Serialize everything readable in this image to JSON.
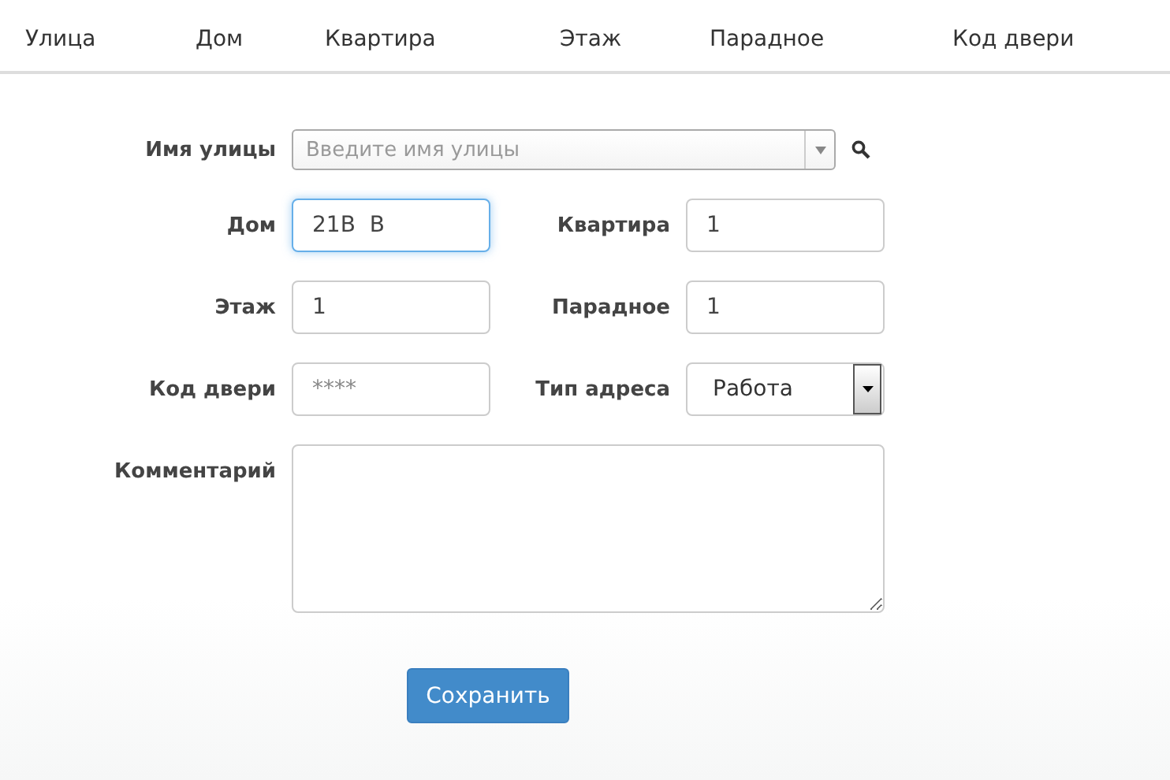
{
  "header": {
    "columns": [
      "Улица",
      "Дом",
      "Квартира",
      "Этаж",
      "Парадное",
      "Код двери"
    ]
  },
  "form": {
    "street": {
      "label": "Имя улицы",
      "placeholder": "Введите имя улицы"
    },
    "fields": [
      {
        "kind": "text",
        "label": "Дом",
        "value": "21В  В",
        "focused": true
      },
      {
        "kind": "text",
        "label": "Квартира",
        "value": "1",
        "focused": false
      },
      {
        "kind": "text",
        "label": "Этаж",
        "value": "1",
        "focused": false
      },
      {
        "kind": "text",
        "label": "Парадное",
        "value": "1",
        "focused": false
      },
      {
        "kind": "text",
        "label": "Код двери",
        "placeholder": "****",
        "focused": false
      },
      {
        "kind": "select",
        "label": "Тип адреса",
        "value": "Работа",
        "focused": false
      }
    ],
    "comment": {
      "label": "Комментарий"
    },
    "save_button": "Сохранить"
  }
}
